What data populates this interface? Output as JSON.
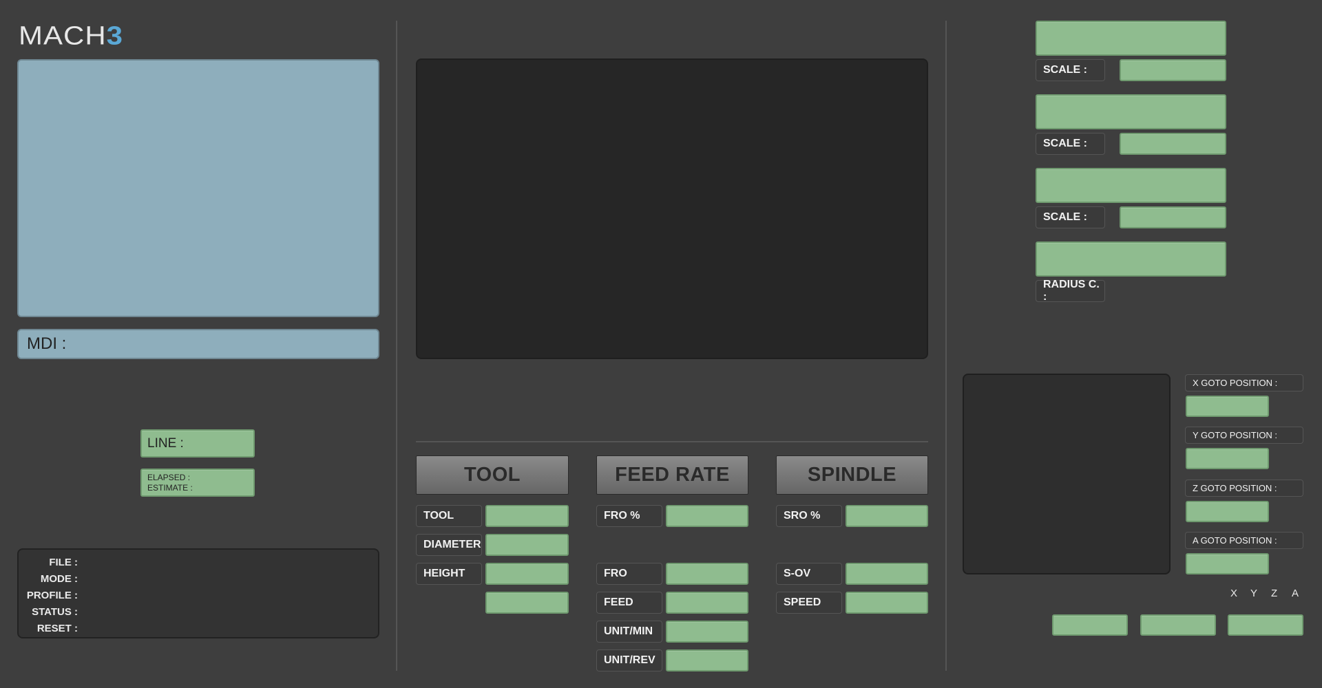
{
  "app": {
    "logo_text": "MACH",
    "logo_accent": "3"
  },
  "left": {
    "mdi_label": "MDI :",
    "line_label": "LINE :",
    "elapsed_label": "ELAPSED :",
    "estimate_label": "ESTIMATE :",
    "info": {
      "file": "FILE :",
      "mode": "MODE :",
      "profile": "PROFILE :",
      "status": "STATUS :",
      "reset": "RESET :"
    }
  },
  "dro": {
    "scale_label": "SCALE :",
    "radius_label": "RADIUS C. :"
  },
  "tool_section": {
    "button": "TOOL",
    "tool_label": "TOOL",
    "diameter_label": "DIAMETER",
    "height_label": "HEIGHT"
  },
  "feed_section": {
    "button": "FEED RATE",
    "fro_pct_label": "FRO %",
    "fro_label": "FRO",
    "feed_label": "FEED",
    "unit_min_label": "UNIT/MIN",
    "unit_rev_label": "UNIT/REV"
  },
  "spindle_section": {
    "button": "SPINDLE",
    "sro_pct_label": "SRO %",
    "sov_label": "S-OV",
    "speed_label": "SPEED"
  },
  "goto": {
    "x_label": "X GOTO POSITION  :",
    "y_label": "Y GOTO POSITION  :",
    "z_label": "Z GOTO POSITION :",
    "a_label": "A GOTO POSITION :"
  },
  "axes": [
    "X",
    "Y",
    "Z",
    "A"
  ],
  "colors": {
    "background": "#3e3e3e",
    "display_green": "#8fbc8f",
    "panel_blue": "#8eaebc",
    "logo_accent": "#5aa8d6"
  }
}
